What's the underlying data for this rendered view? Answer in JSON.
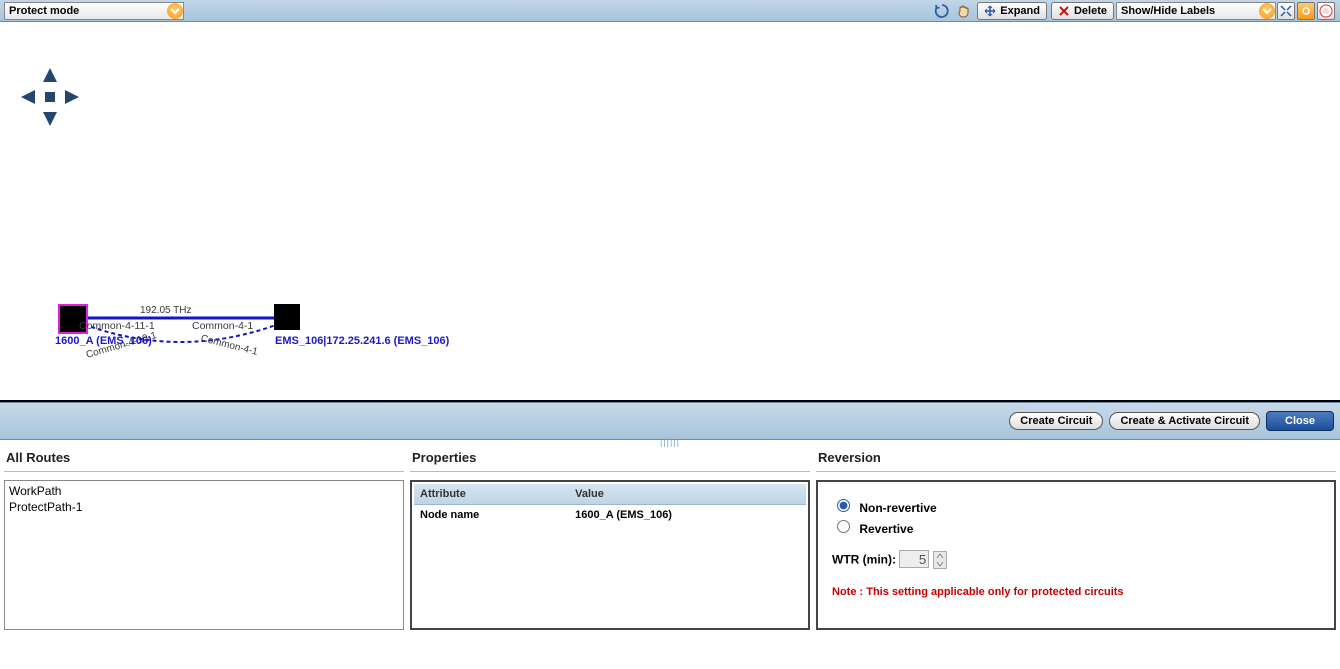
{
  "toolbar": {
    "mode_label": "Protect mode",
    "expand_label": "Expand",
    "delete_label": "Delete",
    "show_hide_label": "Show/Hide Labels"
  },
  "canvas": {
    "freq_label": "192.05 THz",
    "node_a_label": "1600_A (EMS_106)",
    "node_b_label": "EMS_106|172.25.241.6 (EMS_106)",
    "port_a": "Common-4-11-1",
    "port_b": "Common-4-1",
    "port_a2": "Common-4-10-1",
    "port_b2": "Common-4-1"
  },
  "midbar": {
    "create_label": "Create Circuit",
    "create_activate_label": "Create & Activate Circuit",
    "close_label": "Close"
  },
  "routes": {
    "title": "All Routes",
    "items": [
      "WorkPath",
      "ProtectPath-1"
    ]
  },
  "properties": {
    "title": "Properties",
    "columns": [
      "Attribute",
      "Value"
    ],
    "rows": [
      {
        "attr": "Node name",
        "val": "1600_A (EMS_106)"
      }
    ]
  },
  "reversion": {
    "title": "Reversion",
    "non_revertive_label": "Non-revertive",
    "revertive_label": "Revertive",
    "wtr_label": "WTR (min):",
    "wtr_value": "5",
    "note": "Note : This setting applicable only for protected circuits"
  }
}
